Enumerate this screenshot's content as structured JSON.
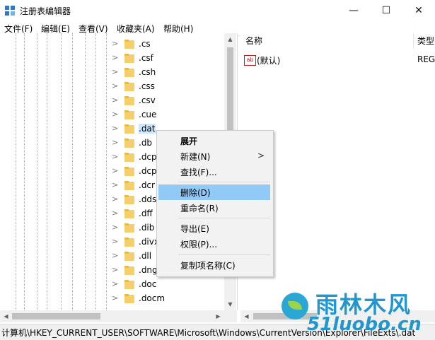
{
  "window": {
    "title": "注册表编辑器",
    "minimize": "—",
    "maximize": "☐",
    "close": "✕"
  },
  "menu": [
    "文件(F)",
    "编辑(E)",
    "查看(V)",
    "收藏夹(A)",
    "帮助(H)"
  ],
  "tree": {
    "items": [
      ".cs",
      ".csf",
      ".csh",
      ".css",
      ".csv",
      ".cue",
      ".dat",
      ".db",
      ".dcp",
      ".dcp",
      ".dcr",
      ".dds",
      ".dff",
      ".dib",
      ".divx",
      ".dll",
      ".dng",
      ".doc",
      ".docm"
    ],
    "selected_index": 6
  },
  "values": {
    "headers": {
      "name": "名称",
      "type": "类型"
    },
    "rows": [
      {
        "icon": "ab",
        "name": "(默认)",
        "type": "REG"
      }
    ]
  },
  "context_menu": {
    "items": [
      {
        "label": "展开",
        "bold": true,
        "submenu": ""
      },
      {
        "label": "新建(N)",
        "submenu": ">"
      },
      {
        "label": "查找(F)...",
        "submenu": ""
      },
      {
        "label": "删除(D)",
        "highlighted": true,
        "submenu": ""
      },
      {
        "label": "重命名(R)",
        "submenu": ""
      },
      {
        "label": "导出(E)",
        "submenu": ""
      },
      {
        "label": "权限(P)...",
        "submenu": ""
      },
      {
        "label": "复制项名称(C)",
        "submenu": ""
      }
    ]
  },
  "statusbar": {
    "path": "计算机\\HKEY_CURRENT_USER\\SOFTWARE\\Microsoft\\Windows\\CurrentVersion\\Explorer\\FileExts\\.dat"
  },
  "watermark": {
    "title": "雨林木风",
    "url": "51luobo.cn"
  },
  "colors": {
    "folder": "#f5cf6b",
    "highlight": "#91c9f7",
    "watermark": "#2197cf"
  }
}
